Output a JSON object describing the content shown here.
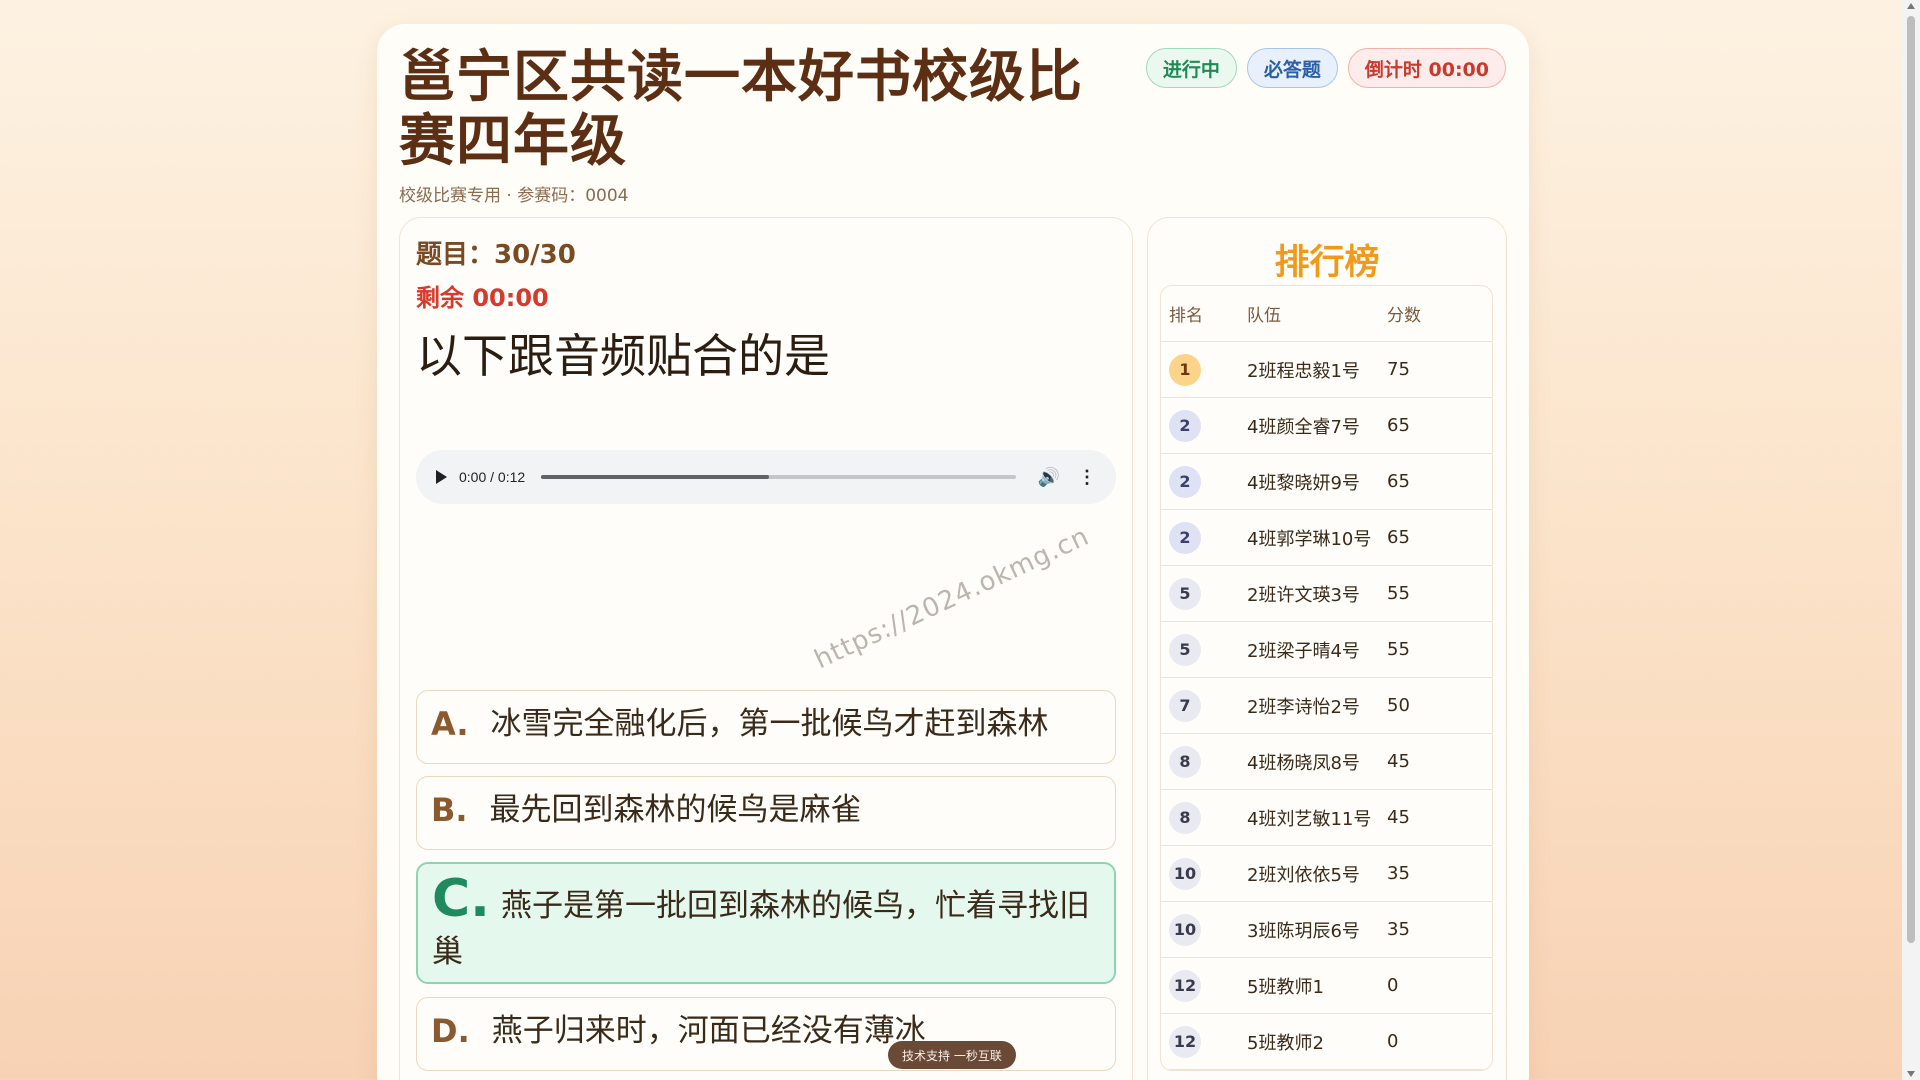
{
  "header": {
    "title": "邕宁区共读一本好书校级比赛四年级",
    "subtitle": "校级比赛专用 · 参赛码：0004",
    "badges": {
      "status": "进行中",
      "required": "必答题",
      "countdown": "倒计时 00:00"
    }
  },
  "question": {
    "number_label": "题目：30/30",
    "remaining_label": "剩余 00:00",
    "text": "以下跟音频贴合的是",
    "audio": {
      "time": "0:00 / 0:12",
      "progress": 0.48
    },
    "watermark": "https://2024.okmg.cn",
    "options": [
      {
        "letter": "A.",
        "text": "冰雪完全融化后，第一批候鸟才赶到森林",
        "correct": false
      },
      {
        "letter": "B.",
        "text": "最先回到森林的候鸟是麻雀",
        "correct": false
      },
      {
        "letter": "C.",
        "text": "燕子是第一批回到森林的候鸟，忙着寻找旧巢",
        "correct": true
      },
      {
        "letter": "D.",
        "text": "燕子归来时，河面已经没有薄冰",
        "correct": false
      }
    ]
  },
  "leaderboard": {
    "title": "排行榜",
    "columns": [
      "排名",
      "队伍",
      "分数"
    ],
    "rows": [
      {
        "rank": "1",
        "team": "2班程忠毅1号",
        "score": "75"
      },
      {
        "rank": "2",
        "team": "4班颜全睿7号",
        "score": "65"
      },
      {
        "rank": "2",
        "team": "4班黎晓妍9号",
        "score": "65"
      },
      {
        "rank": "2",
        "team": "4班郭学琳10号",
        "score": "65"
      },
      {
        "rank": "5",
        "team": "2班许文瑛3号",
        "score": "55"
      },
      {
        "rank": "5",
        "team": "2班梁子晴4号",
        "score": "55"
      },
      {
        "rank": "7",
        "team": "2班李诗怡2号",
        "score": "50"
      },
      {
        "rank": "8",
        "team": "4班杨晓凤8号",
        "score": "45"
      },
      {
        "rank": "8",
        "team": "4班刘艺敏11号",
        "score": "45"
      },
      {
        "rank": "10",
        "team": "2班刘依依5号",
        "score": "35"
      },
      {
        "rank": "10",
        "team": "3班陈玥辰6号",
        "score": "35"
      },
      {
        "rank": "12",
        "team": "5班教师1",
        "score": "0"
      },
      {
        "rank": "12",
        "team": "5班教师2",
        "score": "0"
      }
    ]
  },
  "footer": {
    "support": "技术支持 一秒互联"
  },
  "colors": {
    "accent": "#f19a1a",
    "title": "#5c2f14",
    "correct": "#1f8a5e",
    "danger": "#d63a2c"
  }
}
